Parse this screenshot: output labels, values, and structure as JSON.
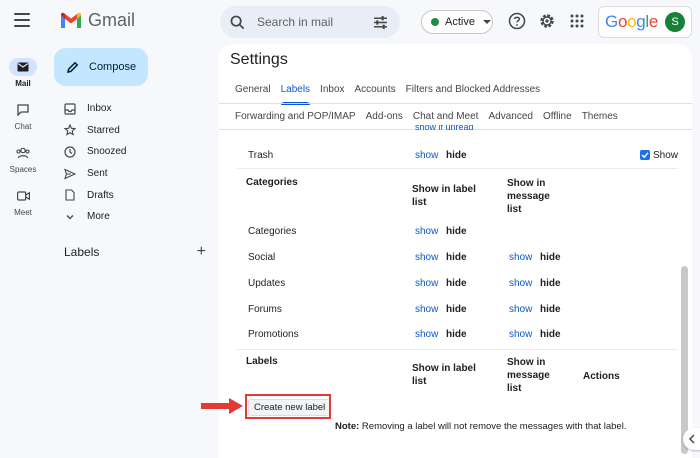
{
  "header": {
    "menu_icon": "hamburger-icon",
    "app_name": "Gmail",
    "search_placeholder": "Search in mail",
    "status": "Active",
    "google_word": "Google",
    "avatar_initial": "S",
    "colors": {
      "status_green": "#1e8e3e",
      "avatar": "#188038",
      "accent": "#0b57d0",
      "highlight": "#e53935"
    }
  },
  "rail": [
    {
      "label": "Mail",
      "icon": "mail-icon",
      "active": true
    },
    {
      "label": "Chat",
      "icon": "chat-icon",
      "active": false
    },
    {
      "label": "Spaces",
      "icon": "spaces-icon",
      "active": false
    },
    {
      "label": "Meet",
      "icon": "meet-icon",
      "active": false
    }
  ],
  "nav": {
    "compose": "Compose",
    "items": [
      {
        "label": "Inbox",
        "icon": "inbox-icon"
      },
      {
        "label": "Starred",
        "icon": "star-icon"
      },
      {
        "label": "Snoozed",
        "icon": "clock-icon"
      },
      {
        "label": "Sent",
        "icon": "send-icon"
      },
      {
        "label": "Drafts",
        "icon": "draft-icon"
      },
      {
        "label": "More",
        "icon": "chevron-down-icon"
      }
    ],
    "labels_heading": "Labels",
    "add_label": "+"
  },
  "settings": {
    "title": "Settings",
    "tabs_row1": [
      "General",
      "Labels",
      "Inbox",
      "Accounts",
      "Filters and Blocked Addresses"
    ],
    "tabs_row2": [
      "Forwarding and POP/IMAP",
      "Add-ons",
      "Chat and Meet",
      "Advanced",
      "Offline",
      "Themes"
    ],
    "active_tab": "Labels",
    "scrolled_text": "show if unread",
    "trash": {
      "label": "Trash",
      "show": "show",
      "hide": "hide",
      "checkbox_label": "Show"
    },
    "categories_section": {
      "heading": "Categories",
      "col1": "Show in label list",
      "col2": "Show in message list",
      "rows": [
        {
          "label": "Categories",
          "show": "show",
          "hide": "hide"
        },
        {
          "label": "Social",
          "show": "show",
          "hide": "hide",
          "show2": "show",
          "hide2": "hide"
        },
        {
          "label": "Updates",
          "show": "show",
          "hide": "hide",
          "show2": "show",
          "hide2": "hide"
        },
        {
          "label": "Forums",
          "show": "show",
          "hide": "hide",
          "show2": "show",
          "hide2": "hide"
        },
        {
          "label": "Promotions",
          "show": "show",
          "hide": "hide",
          "show2": "show",
          "hide2": "hide"
        }
      ]
    },
    "labels_section": {
      "heading": "Labels",
      "col1": "Show in label list",
      "col2": "Show in message list",
      "col3": "Actions"
    },
    "create_button": "Create new label",
    "note_bold": "Note:",
    "note_text": " Removing a label will not remove the messages with that label."
  }
}
